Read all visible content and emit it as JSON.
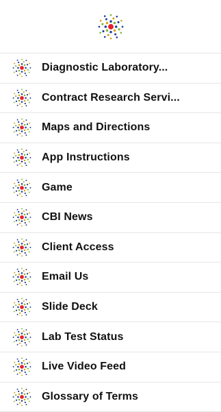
{
  "header": {
    "logo_icon": "cbi-starburst-logo-icon"
  },
  "colors": {
    "center_dot": "#e8202a",
    "ray_blue": "#1f3f9a",
    "ray_green": "#7fb52f",
    "ray_gold": "#d9a21b",
    "divider": "#e6e6e6",
    "text": "#111111"
  },
  "menu": {
    "items": [
      {
        "label": "Diagnostic Laboratory...",
        "icon": "cbi-starburst-icon"
      },
      {
        "label": "Contract Research Servi...",
        "icon": "cbi-starburst-icon"
      },
      {
        "label": "Maps and Directions",
        "icon": "cbi-starburst-icon"
      },
      {
        "label": "App Instructions",
        "icon": "cbi-starburst-icon"
      },
      {
        "label": "Game",
        "icon": "cbi-starburst-icon"
      },
      {
        "label": "CBI News",
        "icon": "cbi-starburst-icon"
      },
      {
        "label": "Client Access",
        "icon": "cbi-starburst-icon"
      },
      {
        "label": "Email Us",
        "icon": "cbi-starburst-icon"
      },
      {
        "label": "Slide Deck",
        "icon": "cbi-starburst-icon"
      },
      {
        "label": "Lab Test Status",
        "icon": "cbi-starburst-icon"
      },
      {
        "label": "Live Video Feed",
        "icon": "cbi-starburst-icon"
      },
      {
        "label": "Glossary of Terms",
        "icon": "cbi-starburst-icon"
      }
    ]
  }
}
